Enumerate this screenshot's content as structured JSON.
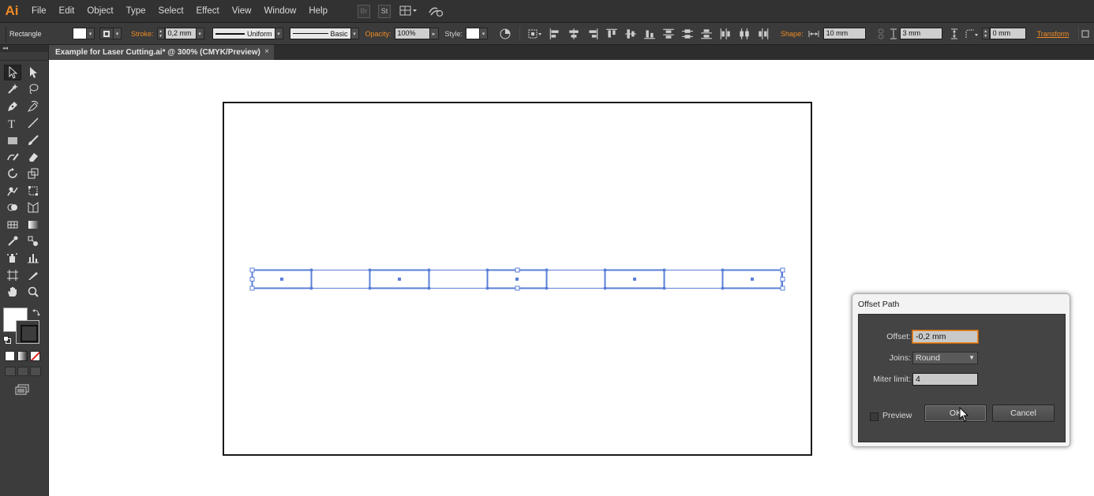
{
  "app": {
    "logo": "Ai",
    "menu": [
      "File",
      "Edit",
      "Object",
      "Type",
      "Select",
      "Effect",
      "View",
      "Window",
      "Help"
    ],
    "bridge_label": "Br",
    "stock_label": "St",
    "arrange_icon": "arrange-documents-icon",
    "sync_icon": "sync-icon"
  },
  "control_bar": {
    "selection_label": "Rectangle",
    "stroke_label": "Stroke:",
    "stroke_weight": "0,2 mm",
    "stroke_profile": "Uniform",
    "brush": "Basic",
    "opacity_label": "Opacity:",
    "opacity_value": "100%",
    "style_label": "Style:",
    "shape_label": "Shape:",
    "shape_width": "10 mm",
    "shape_height": "3 mm",
    "corner_radius": "0 mm",
    "transform_label": "Transform",
    "accent_color": "#f08a24"
  },
  "document": {
    "tab_title": "Example for Laser Cutting.ai* @ 300% (CMYK/Preview)",
    "close_glyph": "×",
    "selection_color": "#5b7fd6"
  },
  "tools_panel": {
    "collapse_glyph": "◂◂",
    "tools": [
      "selection-tool",
      "direct-selection-tool",
      "magic-wand-tool",
      "lasso-tool",
      "pen-tool",
      "curvature-tool",
      "type-tool",
      "line-segment-tool",
      "rectangle-tool",
      "paintbrush-tool",
      "shaper-tool",
      "eraser-tool",
      "rotate-tool",
      "scale-tool",
      "warp-tool",
      "free-transform-tool",
      "shape-builder-tool",
      "perspective-grid-tool",
      "mesh-tool",
      "gradient-tool",
      "eyedropper-tool",
      "blend-tool",
      "symbol-sprayer-tool",
      "column-graph-tool",
      "artboard-tool",
      "slice-tool",
      "hand-tool",
      "zoom-tool"
    ],
    "fill_color": "#ffffff",
    "stroke_color": "#111111"
  },
  "dialog": {
    "title": "Offset Path",
    "offset_label": "Offset:",
    "offset_value": "-0,2 mm",
    "joins_label": "Joins:",
    "joins_value": "Round",
    "miter_label": "Miter limit:",
    "miter_value": "4",
    "preview_label": "Preview",
    "ok_label": "OK",
    "cancel_label": "Cancel"
  }
}
